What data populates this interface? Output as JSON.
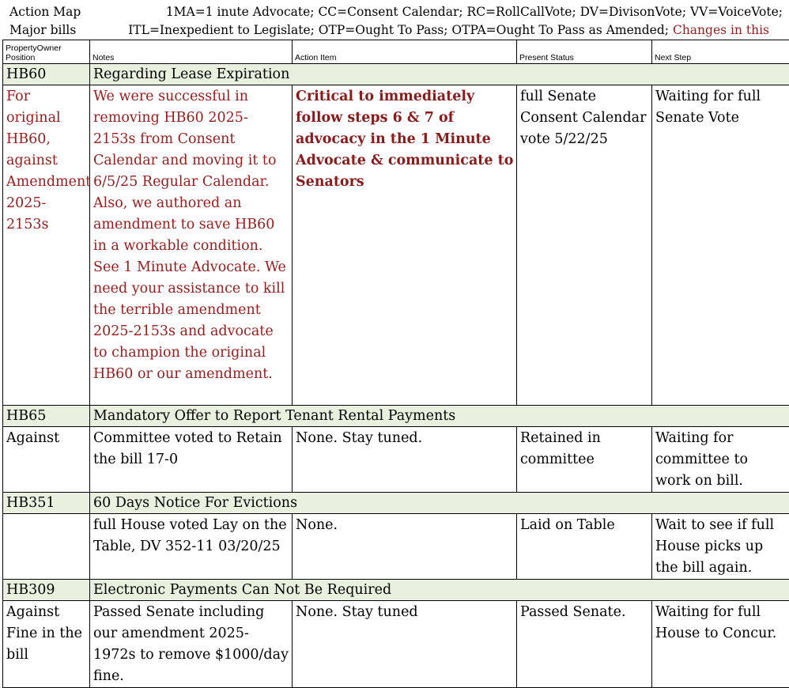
{
  "header": {
    "title_line1": "Action Map",
    "title_line2": "Major bills",
    "legend_line1": "1MA=1 inute Advocate; CC=Consent Calendar; RC=RollCallVote; DV=DivisonVote; VV=VoiceVote;",
    "legend_line2_main": "ITL=Inexpedient to Legislate; OTP=Ought To Pass; OTPA=Ought To Pass as Amended;",
    "legend_line2_changes": "Changes in this"
  },
  "colors": {
    "changes_red": "#9c1a1a",
    "bill_header_bg": "#eaf0de"
  },
  "columns": {
    "position": "PropertyOwner Position",
    "notes": "Notes",
    "action": "Action Item",
    "status": "Present Status",
    "next": "Next Step"
  },
  "bills": [
    {
      "id": "HB60",
      "title": "Regarding Lease Expiration",
      "position": "For original HB60, against Amendment 2025-2153s",
      "notes": "We were successful in removing HB60 2025-2153s from Consent Calendar and moving it to 6/5/25 Regular Calendar. Also, we authored an amendment to save HB60 in a workable condition. See 1 Minute Advocate.  We need your assistance to kill the terrible amendment 2025-2153s and advocate to champion the original HB60 or our amendment.",
      "action": "Critical to immediately follow steps 6 & 7 of advocacy in the 1 Minute Advocate & communicate to Senators",
      "status": "full Senate Consent Calendar vote 5/22/25",
      "next": "Waiting for full Senate Vote"
    },
    {
      "id": "HB65",
      "title": "Mandatory Offer to Report Tenant Rental Payments",
      "position": "Against",
      "notes": "Committee voted to Retain the bill 17-0",
      "action": "None.  Stay tuned.",
      "status": "Retained in committee",
      "next": "Waiting for committee to work on bill."
    },
    {
      "id": "HB351",
      "title": "60 Days Notice For Evictions",
      "position": "",
      "notes": "full House voted Lay on the Table, DV 352-11 03/20/25",
      "action": "None.",
      "status": "Laid on Table",
      "next": "Wait to see if full House picks up the bill again."
    },
    {
      "id": "HB309",
      "title": "Electronic Payments Can Not Be Required",
      "position": "Against Fine in the bill",
      "notes": "Passed Senate including our amendment 2025-1972s to remove $1000/day fine.",
      "action": "None. Stay tuned",
      "status": "Passed Senate.",
      "next": "Waiting for full House to Concur."
    }
  ]
}
